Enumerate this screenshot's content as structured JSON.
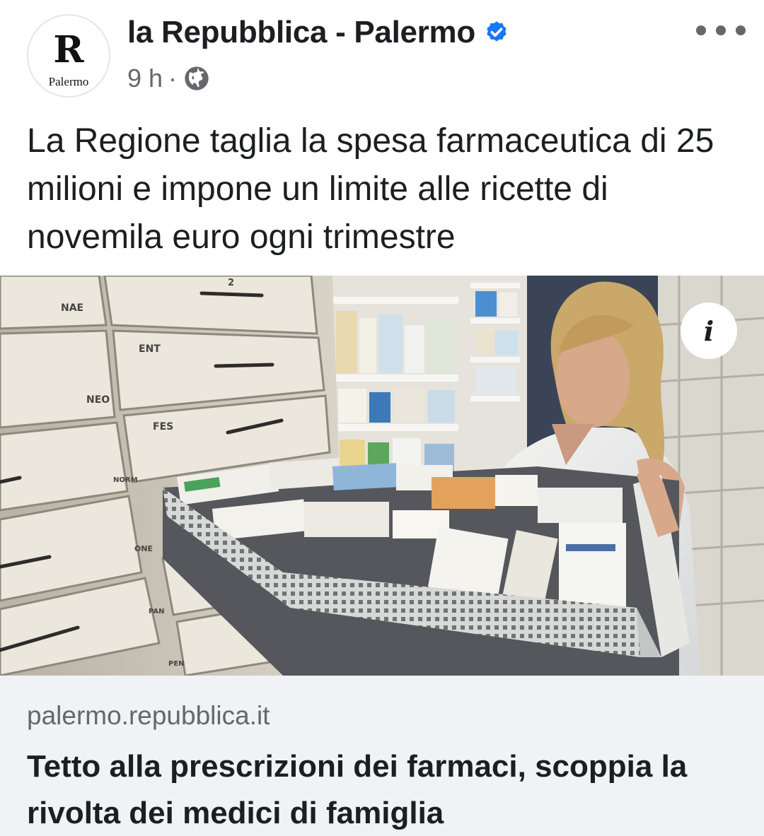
{
  "post": {
    "avatar_letter": "R",
    "avatar_city": "Palermo",
    "page_name": "la Repubblica - Palermo",
    "time": "9 h",
    "separator": "·",
    "privacy_icon": "globe-icon",
    "verified_icon": "verified-badge-icon",
    "more_icon": "more-options-icon",
    "text": "La Regione taglia la spesa farmaceutica di 25 milioni e impone un limite alle ricette di novemila euro ogni trimestre"
  },
  "photo": {
    "info_glyph": "i",
    "drawer_labels": [
      "NAE",
      "ENT",
      "NEO",
      "FES",
      "NORM",
      "ONE",
      "PAN",
      "PEN",
      "2"
    ]
  },
  "link": {
    "domain": "palermo.repubblica.it",
    "title": "Tetto alla prescrizioni dei farmaci, scoppia la rivolta dei medici di famiglia"
  },
  "colors": {
    "verified_blue": "#1877f2",
    "meta_gray": "#65676b",
    "link_bg": "#f0f2f5"
  }
}
